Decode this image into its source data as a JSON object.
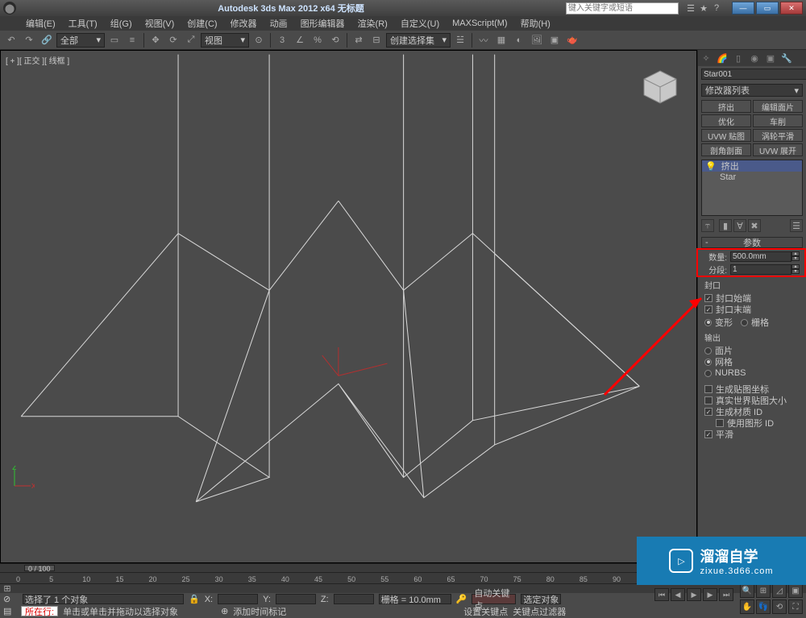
{
  "title": "Autodesk 3ds Max 2012 x64   无标题",
  "search_placeholder": "键入关键字或短语",
  "menu": [
    "编辑(E)",
    "工具(T)",
    "组(G)",
    "视图(V)",
    "创建(C)",
    "修改器",
    "动画",
    "图形编辑器",
    "渲染(R)",
    "自定义(U)",
    "MAXScript(M)",
    "帮助(H)"
  ],
  "toolbar": {
    "sel_filter": "全部",
    "view_mode": "视图",
    "create_list": "创建选择集"
  },
  "viewport": {
    "label": "[ + ][ 正交 ][ 线框 ]"
  },
  "cmd": {
    "object_name": "Star001",
    "mod_list_label": "修改器列表",
    "btns": [
      "挤出",
      "编辑面片",
      "优化",
      "车削",
      "UVW 贴图",
      "涡轮平滑",
      "剖角剖面",
      "UVW 展开"
    ],
    "stack": [
      {
        "label": "挤出",
        "selected": true,
        "bulb": true
      },
      {
        "label": "Star",
        "selected": false,
        "bulb": false
      }
    ],
    "params_head": "参数",
    "amount_label": "数量:",
    "amount_value": "500.0mm",
    "segs_label": "分段:",
    "segs_value": "1",
    "cap_head": "封口",
    "cap_start": "封口始端",
    "cap_end": "封口末端",
    "cap_morph": "变形",
    "cap_grid": "栅格",
    "output_head": "输出",
    "out_patch": "面片",
    "out_mesh": "网格",
    "out_nurbs": "NURBS",
    "gen_map": "生成贴图坐标",
    "real_world": "真实世界贴图大小",
    "gen_mat": "生成材质 ID",
    "use_shape": "使用图形 ID",
    "smooth": "平滑"
  },
  "timeline": {
    "frame": "0 / 100"
  },
  "ruler_ticks": [
    "0",
    "5",
    "10",
    "15",
    "20",
    "25",
    "30",
    "35",
    "40",
    "45",
    "50",
    "55",
    "60",
    "65",
    "70",
    "75",
    "80",
    "85",
    "90"
  ],
  "status": {
    "sel_text": "选择了 1 个对象",
    "x": "X:",
    "y": "Y:",
    "z": "Z:",
    "grid": "栅格 = 10.0mm",
    "autokey": "自动关键点",
    "selset": "选定对象",
    "prompt_label": "所在行:",
    "hint": "单击或单击并拖动以选择对象",
    "add_time": "添加时间标记",
    "setkey": "设置关键点",
    "keyfilter": "关键点过滤器"
  },
  "watermark": {
    "main": "溜溜自学",
    "sub": "zixue.3d66.com"
  }
}
